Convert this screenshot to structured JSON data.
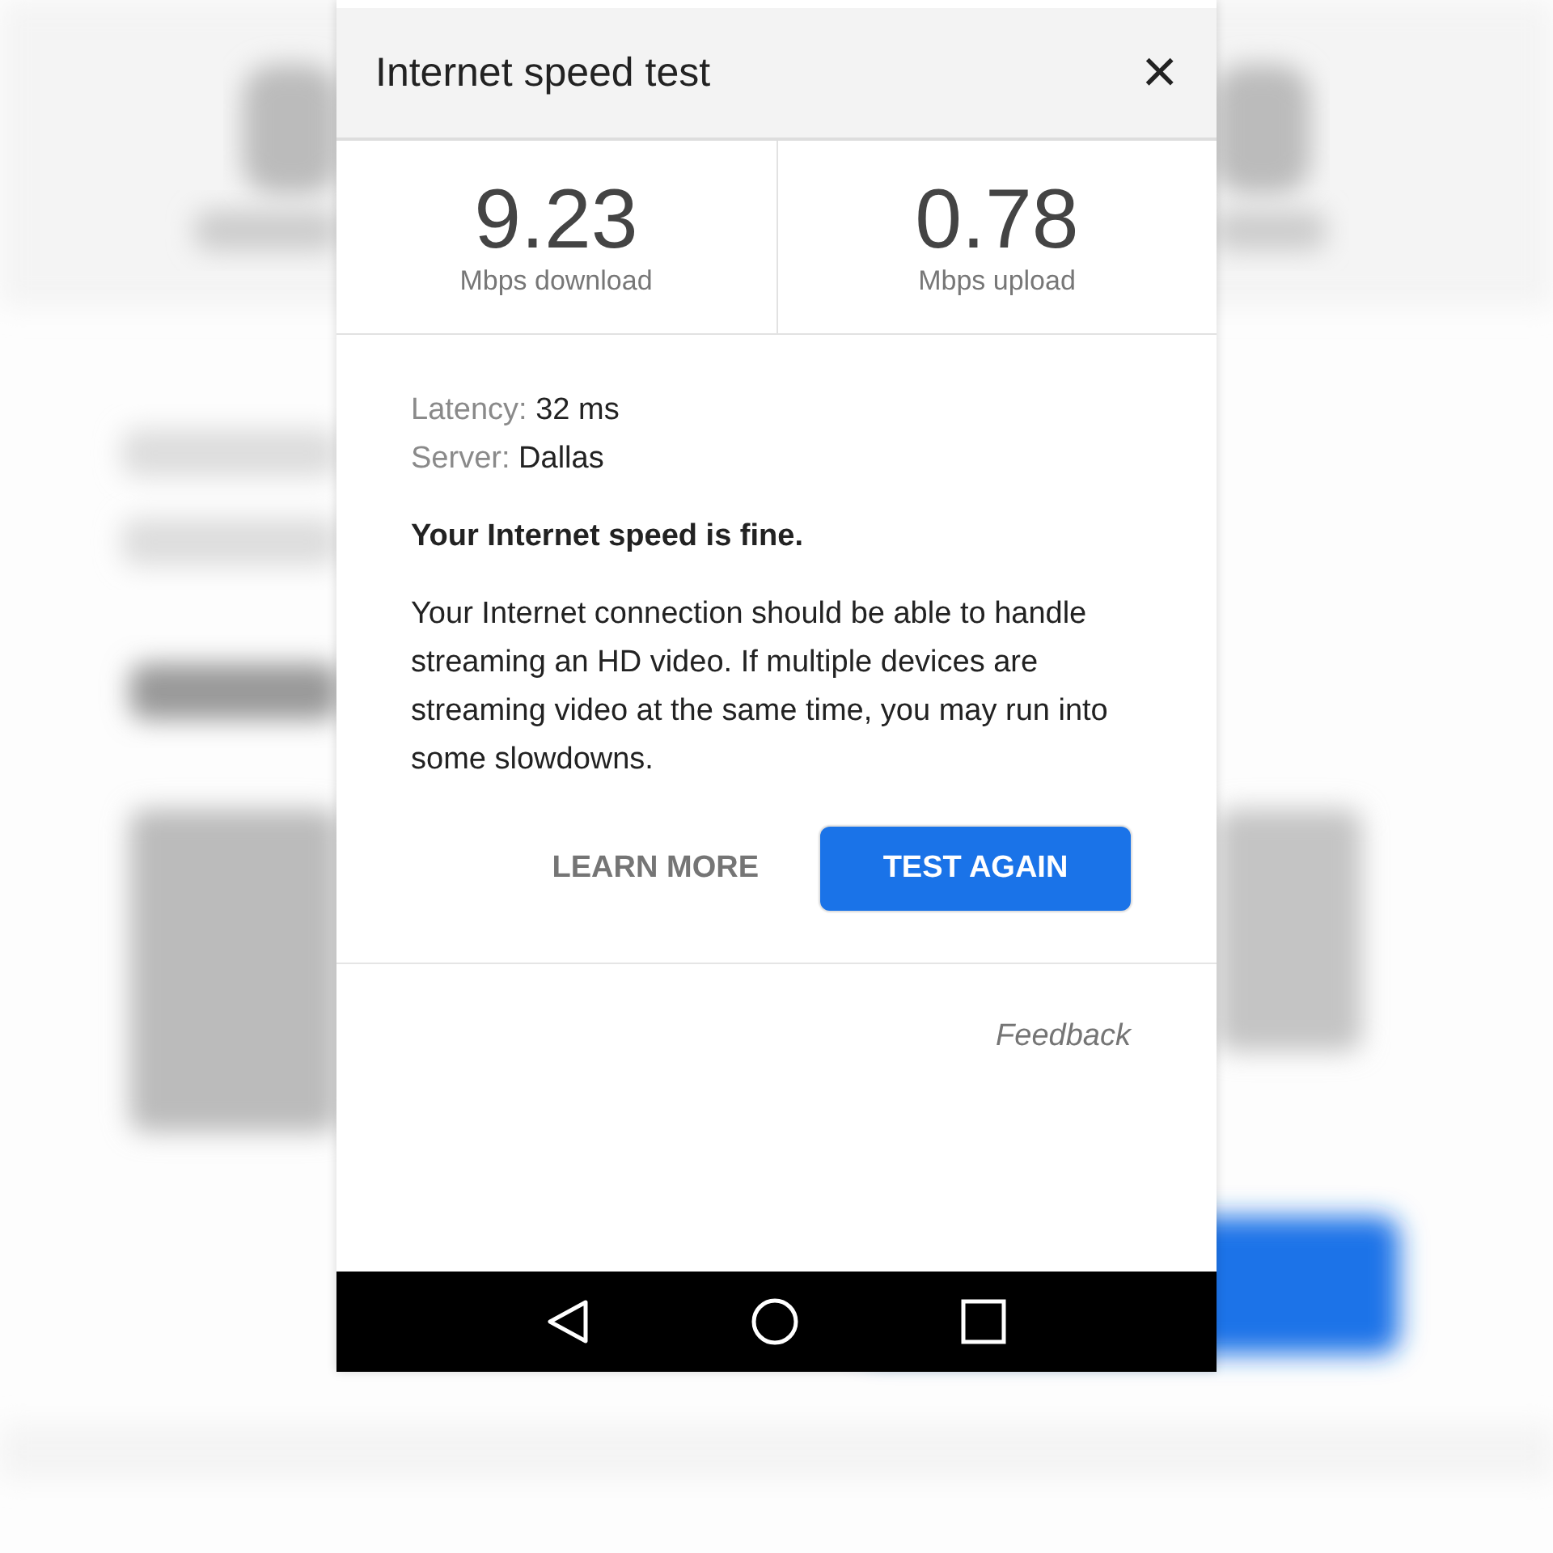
{
  "dialog": {
    "title": "Internet speed test",
    "close": "×"
  },
  "results": [
    {
      "value": "9.23",
      "label": "Mbps download"
    },
    {
      "value": "0.78",
      "label": "Mbps upload"
    }
  ],
  "details": [
    {
      "label": "Latency:",
      "value": "32 ms"
    },
    {
      "label": "Server:",
      "value": "Dallas"
    }
  ],
  "verdict": "Your Internet speed is fine.",
  "description": "Your Internet connection should be able to handle streaming an HD video. If multiple devices are streaming video at the same time, you may run into some slowdowns.",
  "buttons": [
    {
      "label": "LEARN MORE",
      "kind": "text"
    },
    {
      "label": "TEST AGAIN",
      "kind": "primary"
    }
  ],
  "feedback": "Feedback"
}
